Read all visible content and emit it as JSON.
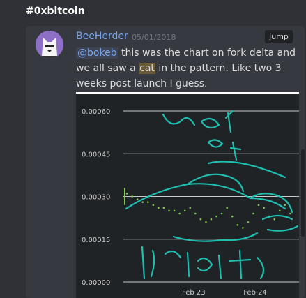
{
  "channel": {
    "name": "#0xbitcoin"
  },
  "message": {
    "author": "BeeHerder",
    "timestamp": "05/01/2018",
    "jump_label": "Jump",
    "mention": "@bokeb",
    "text_before_highlight": " this was the chart on fork delta and we all saw a ",
    "highlight": "cat",
    "text_after_highlight": " in the pattern. Like two 3 weeks post launch I guess."
  },
  "chart_data": {
    "type": "scatter",
    "y_ticks": [
      "0.00060",
      "0.00045",
      "0.00030",
      "0.00015",
      "0.00000"
    ],
    "x_ticks": [
      "Feb 23",
      "Feb 24"
    ],
    "ylim": [
      0,
      0.0006
    ],
    "grid": true,
    "annotations": [
      "goat",
      "of",
      "profits"
    ],
    "annotation_color": "#1fbfb0",
    "series": [
      {
        "color": "#7ec850",
        "points": [
          [
            0.02,
            0.00031
          ],
          [
            0.05,
            0.0003
          ],
          [
            0.08,
            0.00029
          ],
          [
            0.11,
            0.00028
          ],
          [
            0.14,
            0.00028
          ],
          [
            0.17,
            0.00027
          ],
          [
            0.2,
            0.00026
          ],
          [
            0.23,
            0.00026
          ],
          [
            0.26,
            0.00025
          ],
          [
            0.29,
            0.00025
          ],
          [
            0.32,
            0.00024
          ],
          [
            0.35,
            0.00025
          ],
          [
            0.38,
            0.00026
          ],
          [
            0.41,
            0.00024
          ],
          [
            0.44,
            0.00022
          ],
          [
            0.47,
            0.00021
          ],
          [
            0.5,
            0.00022
          ],
          [
            0.53,
            0.00023
          ],
          [
            0.56,
            0.00024
          ],
          [
            0.59,
            0.00026
          ],
          [
            0.62,
            0.00023
          ],
          [
            0.65,
            0.0002
          ],
          [
            0.68,
            0.00019
          ],
          [
            0.71,
            0.00021
          ],
          [
            0.74,
            0.00024
          ],
          [
            0.77,
            0.00027
          ],
          [
            0.8,
            0.00026
          ],
          [
            0.83,
            0.00023
          ],
          [
            0.86,
            0.00022
          ],
          [
            0.89,
            0.00025
          ],
          [
            0.92,
            0.00027
          ],
          [
            0.95,
            0.00024
          ]
        ]
      }
    ]
  }
}
